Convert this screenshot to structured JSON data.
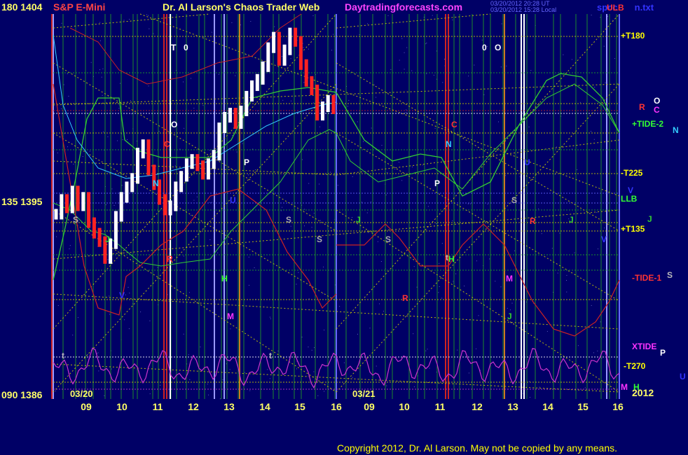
{
  "header": {
    "y_top_label": "180  1404",
    "instrument": "S&P E-Mini",
    "title": "Dr. Al Larson's Chaos Trader Web",
    "site": "Daytradingforecasts.com",
    "date_line1": "03/20/2012 20:28 UT",
    "date_line2": "03/20/2012 15:28 Local",
    "file": "spcc",
    "file_tail": "n.txt"
  },
  "price_axis": {
    "top": "180  1404",
    "mid": "135  1395",
    "bottom": "090  1386"
  },
  "dates": {
    "day1": "03/20",
    "day2": "03/21",
    "year": "2012"
  },
  "right_labels": [
    {
      "text": "ULB",
      "color": "#ff3333"
    },
    {
      "text": "+T180",
      "color": "#ffff00"
    },
    {
      "text": "R",
      "color": "#ff3333"
    },
    {
      "text": "O",
      "color": "#ffffff"
    },
    {
      "text": "C",
      "color": "#ff33ff"
    },
    {
      "text": "+TIDE-2",
      "color": "#33ff33"
    },
    {
      "text": "N",
      "color": "#33ccff"
    },
    {
      "text": "-T225",
      "color": "#ffff00"
    },
    {
      "text": "V",
      "color": "#3333ff"
    },
    {
      "text": "LLB",
      "color": "#33ff33"
    },
    {
      "text": "J",
      "color": "#33cc33"
    },
    {
      "text": "+T135",
      "color": "#ffff00"
    },
    {
      "text": "-TIDE-1",
      "color": "#ff3333"
    },
    {
      "text": "S",
      "color": "#bbbbbb"
    },
    {
      "text": "XTIDE",
      "color": "#ff33ff"
    },
    {
      "text": "P",
      "color": "#ffffff"
    },
    {
      "text": "-T270",
      "color": "#ffff00"
    },
    {
      "text": "U",
      "color": "#3333ff"
    },
    {
      "text": "M",
      "color": "#ff33ff"
    },
    {
      "text": "H",
      "color": "#33ff33"
    }
  ],
  "planet_markers": [
    {
      "t": "T",
      "c": "#ffffff"
    },
    {
      "t": "0",
      "c": "#ffffff"
    },
    {
      "t": "O",
      "c": "#ffffff"
    },
    {
      "t": "C",
      "c": "#ff3333"
    },
    {
      "t": "N",
      "c": "#33ccff"
    },
    {
      "t": "P",
      "c": "#ffffff"
    },
    {
      "t": "U",
      "c": "#3333ff"
    },
    {
      "t": "S",
      "c": "#aaaaaa"
    },
    {
      "t": "J",
      "c": "#33cc33"
    },
    {
      "t": "R",
      "c": "#ff3333"
    },
    {
      "t": "H",
      "c": "#33ff33"
    },
    {
      "t": "M",
      "c": "#ff33ff"
    },
    {
      "t": "V",
      "c": "#3333ff"
    },
    {
      "t": "S",
      "c": "#aaaaaa"
    },
    {
      "t": "T",
      "c": "#ffffff"
    },
    {
      "t": "0",
      "c": "#ffffff"
    },
    {
      "t": "O",
      "c": "#ffffff"
    },
    {
      "t": "C",
      "c": "#ff3333"
    },
    {
      "t": "N",
      "c": "#33ccff"
    },
    {
      "t": "P",
      "c": "#ffffff"
    },
    {
      "t": "U",
      "c": "#3333ff"
    },
    {
      "t": "S",
      "c": "#aaaaaa"
    },
    {
      "t": "J",
      "c": "#33cc33"
    },
    {
      "t": "S",
      "c": "#aaaaaa"
    },
    {
      "t": "J",
      "c": "#33cc33"
    },
    {
      "t": "V",
      "c": "#3333ff"
    },
    {
      "t": "R",
      "c": "#ff3333"
    },
    {
      "t": "H",
      "c": "#33ff33"
    },
    {
      "t": "M",
      "c": "#ff33ff"
    },
    {
      "t": "J",
      "c": "#33cc33"
    },
    {
      "t": "S",
      "c": "#aaaaaa"
    },
    {
      "t": "R",
      "c": "#ff3333"
    },
    {
      "t": "t",
      "c": "#bbbbbb"
    },
    {
      "t": "t",
      "c": "#bbbbbb"
    },
    {
      "t": "t",
      "c": "#bbbbbb"
    }
  ],
  "footer": {
    "copyright": "Copyright 2012, Dr. Al Larson. May not be copied by any means."
  },
  "colors": {
    "background": "#000066",
    "grid_green": "#22aa22",
    "grid_yellow": "#cccc00",
    "price_bar": "#ffffff",
    "price_bar_down": "#ff2222",
    "tide_green": "#33cc33",
    "tide_red": "#dd2222",
    "xtide": "#cc33cc",
    "cyan": "#33ccff",
    "header_yellow": "#ffff66",
    "header_red": "#ff4444",
    "site_magenta": "#ff44ff",
    "copyright": "#ffff00"
  },
  "chart_data": {
    "type": "line",
    "title": "S&P E-Mini",
    "x_tick_labels": [
      "09",
      "10",
      "11",
      "12",
      "13",
      "14",
      "15",
      "16",
      "09",
      "10",
      "11",
      "12",
      "13",
      "14",
      "15",
      "16"
    ],
    "y_left_labels": [
      "1404",
      "1395",
      "1386"
    ],
    "y_harmonic_labels": [
      "180",
      "135",
      "090"
    ],
    "ylim": [
      1386,
      1404
    ],
    "series": [
      {
        "values": [
          1394.5,
          1395.2,
          1394.8,
          1395.6,
          1394.9,
          1395.3,
          1394.1,
          1393.6,
          1393.2,
          1392.4,
          1393.1,
          1394.4,
          1395.3,
          1395.8,
          1396.2,
          1397.4,
          1397.8,
          1396.6,
          1395.9,
          1395.2,
          1394.7,
          1394.9,
          1395.8,
          1396.3,
          1396.9,
          1397.1,
          1396.8,
          1396.4,
          1396.9,
          1397.3,
          1398.6,
          1399.1,
          1399.3,
          1398.8,
          1399.4,
          1400.1,
          1400.6,
          1400.9,
          1401.5,
          1402.4,
          1402.9,
          1401.8,
          1402.3,
          1403.1,
          1402.7,
          1401.6,
          1400.8,
          1400.4,
          1399.2,
          1399.6,
          1399.9,
          1399.5
        ]
      }
    ]
  }
}
